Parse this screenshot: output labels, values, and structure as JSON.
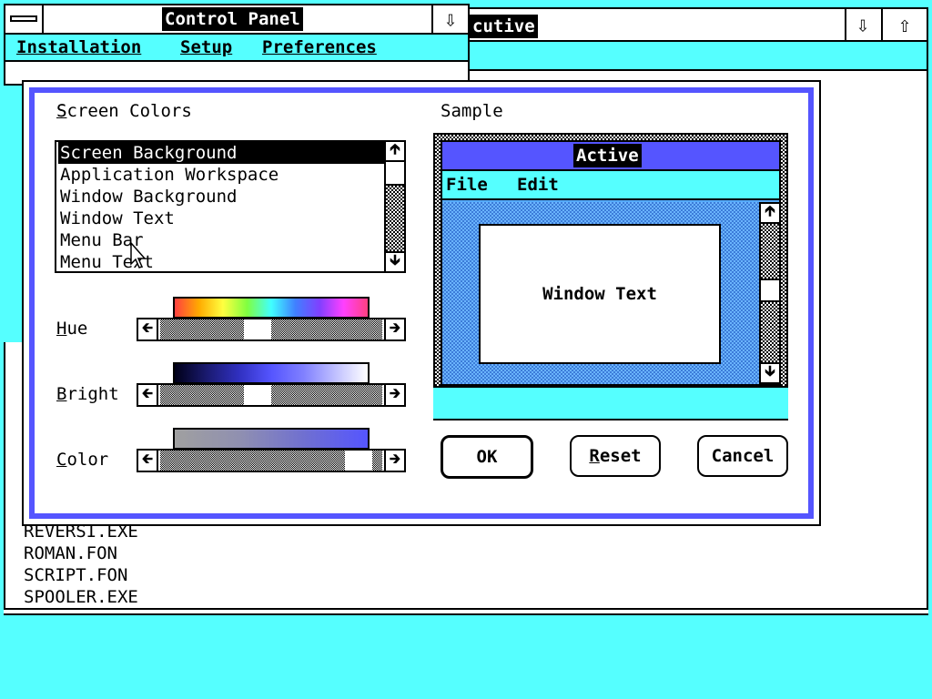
{
  "control_panel": {
    "title": "Control Panel",
    "menu": [
      "Installation",
      "Setup",
      "Preferences"
    ]
  },
  "executive_window": {
    "title_fragment": "cutive"
  },
  "file_list": {
    "items": [
      "REVERSI.EXE",
      "ROMAN.FON",
      "SCRIPT.FON",
      "SPOOLER.EXE"
    ]
  },
  "dialog": {
    "screen_colors_label": "Screen Colors",
    "sample_label": "Sample",
    "color_items": [
      "Screen Background",
      "Application Workspace",
      "Window Background",
      "Window Text",
      "Menu Bar",
      "Menu Text"
    ],
    "selected_item": "Screen Background",
    "hue_label": "Hue",
    "bright_label": "Bright",
    "color_label": "Color",
    "hue_position": 0.43,
    "bright_position": 0.43,
    "color_position": 0.95,
    "ok_label": "OK",
    "reset_label": "Reset",
    "cancel_label": "Cancel"
  },
  "sample": {
    "title": "Active",
    "menu": [
      "File",
      "Edit"
    ],
    "window_text": "Window Text"
  },
  "colors": {
    "desktop": "#55FFFF",
    "title_active": "#5555FF",
    "dialog_border": "#5555FF",
    "sample_menu": "#55FFFF"
  }
}
